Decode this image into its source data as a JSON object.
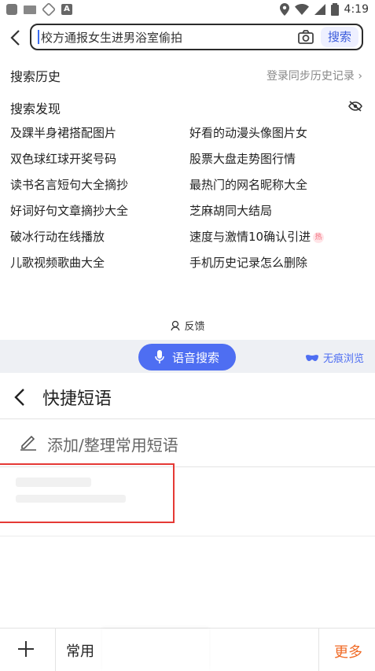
{
  "status_bar": {
    "time": "4:19"
  },
  "search": {
    "query": "校方通报女生进男浴室偷拍",
    "button": "搜索"
  },
  "history": {
    "title": "搜索历史",
    "sync_link": "登录同步历史记录 ›"
  },
  "discovery": {
    "title": "搜索发现",
    "items": [
      {
        "text": "及踝半身裙搭配图片",
        "hot": false
      },
      {
        "text": "好看的动漫头像图片女",
        "hot": false
      },
      {
        "text": "双色球红球开奖号码",
        "hot": false
      },
      {
        "text": "股票大盘走势图行情",
        "hot": false
      },
      {
        "text": "读书名言短句大全摘抄",
        "hot": false
      },
      {
        "text": "最热门的网名昵称大全",
        "hot": false
      },
      {
        "text": "好词好句文章摘抄大全",
        "hot": false
      },
      {
        "text": "芝麻胡同大结局",
        "hot": false
      },
      {
        "text": "破冰行动在线播放",
        "hot": false
      },
      {
        "text": "速度与激情10确认引进",
        "hot": true,
        "badge": "热"
      },
      {
        "text": "儿歌视频歌曲大全",
        "hot": false
      },
      {
        "text": "手机历史记录怎么删除",
        "hot": false
      }
    ]
  },
  "feedback": {
    "label": "反馈"
  },
  "voice": {
    "button": "语音搜索",
    "incognito": "无痕浏览"
  },
  "phrases": {
    "title": "快捷短语",
    "add_label": "添加/整理常用短语"
  },
  "bottom": {
    "tab_common": "常用",
    "more": "更多"
  },
  "colors": {
    "accent": "#4e6ef2",
    "more": "#f06a25",
    "highlight_box": "#e53935"
  }
}
